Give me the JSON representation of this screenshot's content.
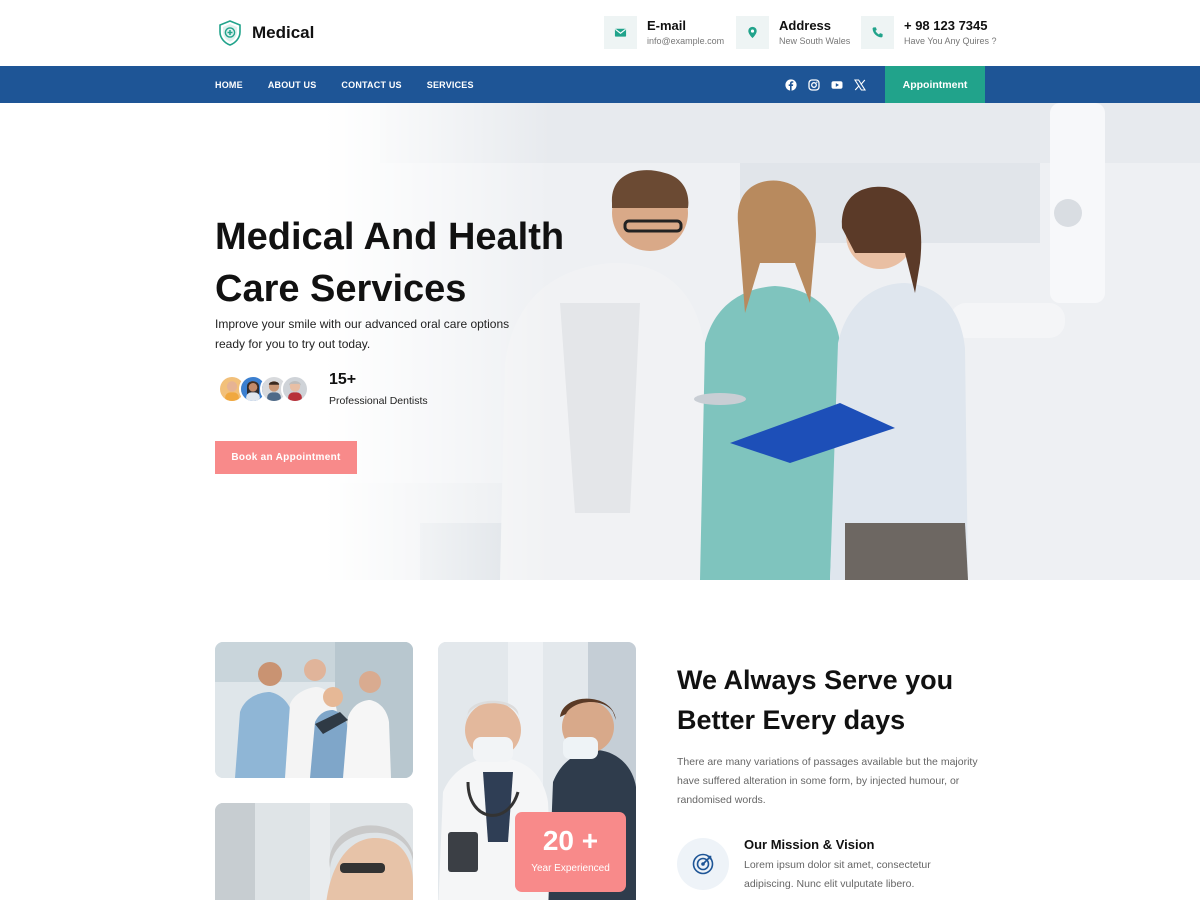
{
  "brand": {
    "name": "Medical",
    "accent": "#21a38b",
    "nav_color": "#1e5596",
    "coral": "#f88a8a"
  },
  "header": {
    "contacts": [
      {
        "title": "E-mail",
        "sub": "info@example.com",
        "icon": "envelope-icon"
      },
      {
        "title": "Address",
        "sub": "New South Wales",
        "icon": "map-pin-icon"
      },
      {
        "title": "+ 98 123 7345",
        "sub": "Have You Any Quires ?",
        "icon": "phone-icon"
      }
    ]
  },
  "nav": {
    "items": [
      "HOME",
      "ABOUT US",
      "CONTACT US",
      "SERVICES"
    ],
    "socials": [
      "facebook-icon",
      "instagram-icon",
      "youtube-icon",
      "x-icon"
    ],
    "appointment_label": "Appointment"
  },
  "hero": {
    "title": "Medical And Health Care Services",
    "subtitle": "Improve your smile with our advanced oral care options ready for you to try out today.",
    "stat_number": "15+",
    "stat_label": "Professional Dentists",
    "button_label": "Book an Appointment"
  },
  "about": {
    "title": "We Always Serve you Better Every days",
    "text": "There are many variations of passages available but the majority have suffered alteration in some form, by injected humour, or randomised words.",
    "experience_number": "20 +",
    "experience_label": "Year Experienced",
    "mission_title": "Our Mission & Vision",
    "mission_text": "Lorem ipsum dolor sit amet, consectetur adipiscing. Nunc elit vulputate libero."
  }
}
